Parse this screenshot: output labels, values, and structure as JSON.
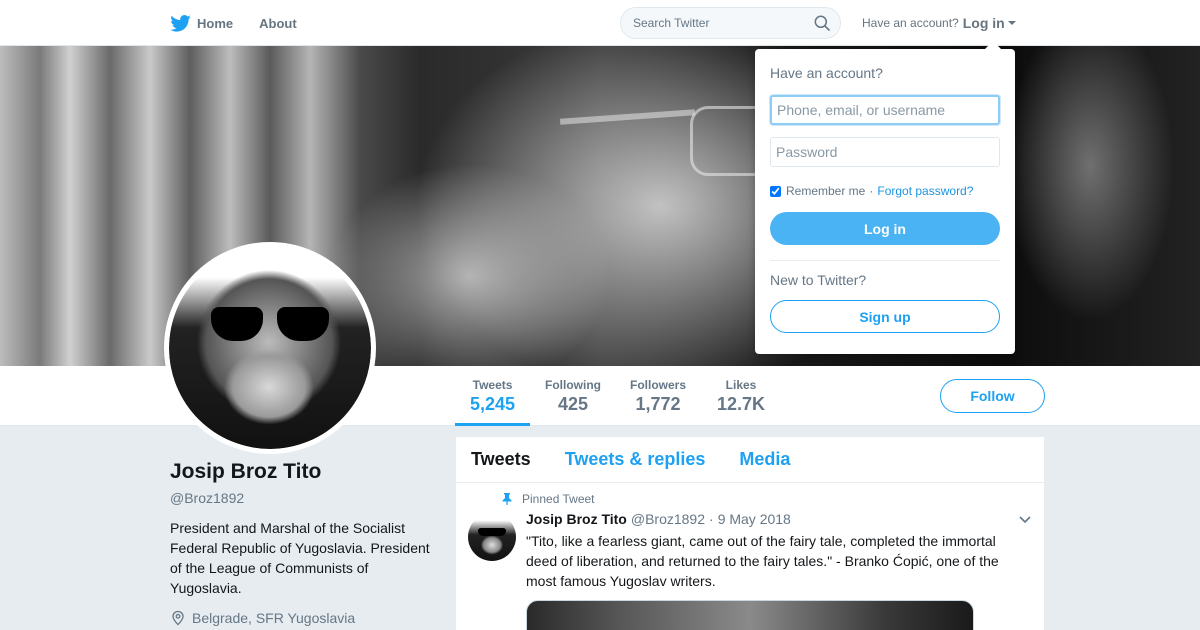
{
  "nav": {
    "home_label": "Home",
    "about_label": "About",
    "search_placeholder": "Search Twitter",
    "have_account": "Have an account?",
    "login_label": "Log in"
  },
  "colors": {
    "brand": "#1da1f2",
    "text": "#14171a",
    "muted": "#657786",
    "background": "#e6ecf0"
  },
  "icons": {
    "logo": "twitter-bird-icon",
    "search": "search-icon",
    "caret": "caret-down-icon",
    "pin": "pin-icon",
    "location": "location-pin-icon",
    "chevron": "chevron-down-icon"
  },
  "login_dropdown": {
    "title": "Have an account?",
    "username_placeholder": "Phone, email, or username",
    "password_placeholder": "Password",
    "remember_label": "Remember me",
    "separator": "·",
    "forgot_label": "Forgot password?",
    "remember_checked": true,
    "login_button": "Log in",
    "new_label": "New to Twitter?",
    "signup_button": "Sign up"
  },
  "stats": {
    "tweets": {
      "label": "Tweets",
      "value": "5,245"
    },
    "following": {
      "label": "Following",
      "value": "425"
    },
    "followers": {
      "label": "Followers",
      "value": "1,772"
    },
    "likes": {
      "label": "Likes",
      "value": "12.7K"
    }
  },
  "follow_button": "Follow",
  "profile": {
    "name": "Josip Broz Tito",
    "handle": "@Broz1892",
    "bio": "President and Marshal of the Socialist Federal Republic of Yugoslavia. President of the League of Communists of Yugoslavia.",
    "location": "Belgrade, SFR Yugoslavia"
  },
  "timeline": {
    "tabs": [
      {
        "label": "Tweets",
        "active": true
      },
      {
        "label": "Tweets & replies",
        "active": false
      },
      {
        "label": "Media",
        "active": false
      }
    ]
  },
  "tweet": {
    "pinned_label": "Pinned Tweet",
    "author": "Josip Broz Tito",
    "handle": "@Broz1892",
    "separator": "·",
    "date": "9 May 2018",
    "text": "\"Tito, like a fearless giant, came out of the fairy tale, completed the immortal deed of liberation, and returned to the fairy tales.\" - Branko Ćopić, one of the most famous Yugoslav writers."
  }
}
